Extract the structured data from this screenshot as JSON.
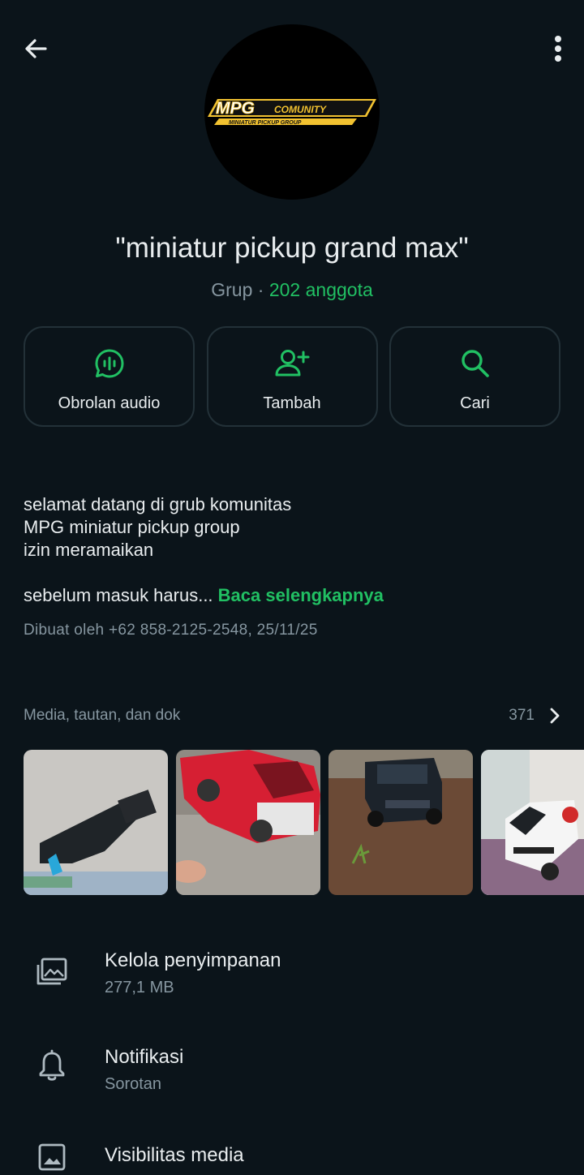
{
  "header": {
    "back_icon": "arrow-left-icon",
    "more_icon": "more-vertical-icon"
  },
  "avatar": {
    "logo_text_main": "MPG",
    "logo_text_side": "COMUNITY",
    "logo_text_sub": "MINIATUR PICKUP GROUP"
  },
  "group": {
    "name": "\"miniatur pickup grand max\"",
    "type_label": "Grup",
    "separator": "·",
    "members": "202 anggota"
  },
  "actions": [
    {
      "label": "Obrolan audio",
      "icon": "audio-chat-icon"
    },
    {
      "label": "Tambah",
      "icon": "add-person-icon"
    },
    {
      "label": "Cari",
      "icon": "search-icon"
    }
  ],
  "description": {
    "line1": "selamat datang di grub komunitas",
    "line2": "MPG miniatur pickup group",
    "line3": "izin meramaikan",
    "line4": "sebelum masuk harus...",
    "read_more": "Baca selengkapnya",
    "created_by": "Dibuat oleh +62 858-2125-2548, 25/11/25"
  },
  "media": {
    "title": "Media, tautan, dan dok",
    "count": "371",
    "chevron_icon": "chevron-right-icon"
  },
  "settings": [
    {
      "title": "Kelola penyimpanan",
      "subtitle": "277,1 MB",
      "icon": "storage-icon"
    },
    {
      "title": "Notifikasi",
      "subtitle": "Sorotan",
      "icon": "bell-icon"
    },
    {
      "title": "Visibilitas media",
      "subtitle": "",
      "icon": "image-icon"
    }
  ],
  "colors": {
    "background": "#0b141a",
    "accent_green": "#21c063",
    "secondary_text": "#8696a0",
    "card_border": "#233138"
  }
}
